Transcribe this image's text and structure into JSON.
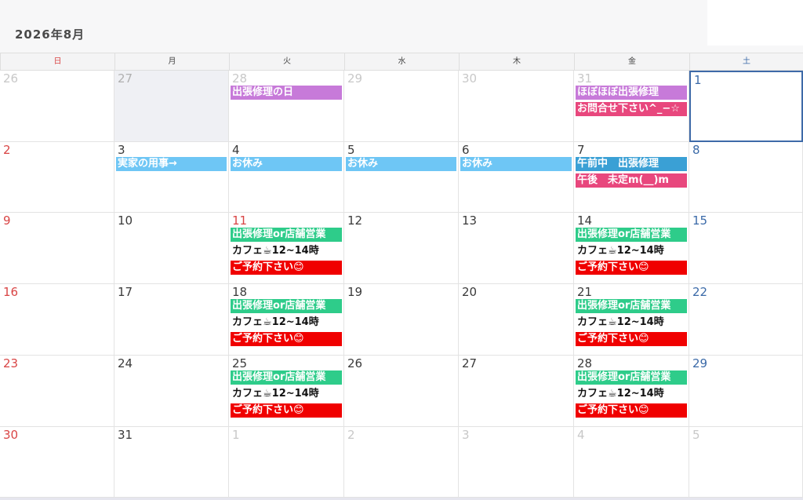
{
  "calendar": {
    "title": "2026年8月",
    "weekdays": [
      "日",
      "月",
      "火",
      "水",
      "木",
      "金",
      "土"
    ],
    "weekday_colors": [
      "#d94545",
      "#444444",
      "#444444",
      "#444444",
      "#444444",
      "#444444",
      "#3b6aa8"
    ],
    "weeks": [
      [
        {
          "day": "26",
          "kind": "other",
          "events": []
        },
        {
          "day": "27",
          "kind": "othergray",
          "gray": true,
          "events": []
        },
        {
          "day": "28",
          "kind": "other",
          "events": [
            {
              "text": "出張修理の日",
              "color": "#c77ad9"
            }
          ]
        },
        {
          "day": "29",
          "kind": "other",
          "events": []
        },
        {
          "day": "30",
          "kind": "other",
          "events": []
        },
        {
          "day": "31",
          "kind": "other",
          "events": [
            {
              "text": "ほぼほぼ出張修理",
              "color": "#c77ad9"
            },
            {
              "text": "お問合せ下さい^_−☆",
              "color": "#e8477d"
            }
          ]
        },
        {
          "day": "1",
          "kind": "sat",
          "selected": true,
          "events": []
        }
      ],
      [
        {
          "day": "2",
          "kind": "sun",
          "events": []
        },
        {
          "day": "3",
          "kind": "normal",
          "events": [
            {
              "text": "実家の用事→",
              "color": "#6ec6f5"
            }
          ]
        },
        {
          "day": "4",
          "kind": "normal",
          "events": [
            {
              "text": "お休み",
              "color": "#6ec6f5"
            }
          ]
        },
        {
          "day": "5",
          "kind": "normal",
          "events": [
            {
              "text": "お休み",
              "color": "#6ec6f5"
            }
          ]
        },
        {
          "day": "6",
          "kind": "normal",
          "events": [
            {
              "text": "お休み",
              "color": "#6ec6f5"
            }
          ]
        },
        {
          "day": "7",
          "kind": "normal",
          "events": [
            {
              "text": "午前中　出張修理",
              "color": "#3aa0d5"
            },
            {
              "text": "午後　未定m(__)m",
              "color": "#e8477d"
            }
          ]
        },
        {
          "day": "8",
          "kind": "sat",
          "events": []
        }
      ],
      [
        {
          "day": "9",
          "kind": "sun",
          "events": []
        },
        {
          "day": "10",
          "kind": "normal",
          "events": []
        },
        {
          "day": "11",
          "kind": "holiday",
          "events": [
            {
              "text": "出張修理or店舗営業",
              "color": "#2ecc8a"
            },
            {
              "text": "カフェ☕12~14時",
              "color": "plain"
            },
            {
              "text": "ご予約下さい😊",
              "color": "#f00000"
            }
          ]
        },
        {
          "day": "12",
          "kind": "normal",
          "events": []
        },
        {
          "day": "13",
          "kind": "normal",
          "events": []
        },
        {
          "day": "14",
          "kind": "normal",
          "events": [
            {
              "text": "出張修理or店舗営業",
              "color": "#2ecc8a"
            },
            {
              "text": "カフェ☕12~14時",
              "color": "plain"
            },
            {
              "text": "ご予約下さい😊",
              "color": "#f00000"
            }
          ]
        },
        {
          "day": "15",
          "kind": "sat",
          "events": []
        }
      ],
      [
        {
          "day": "16",
          "kind": "sun",
          "events": []
        },
        {
          "day": "17",
          "kind": "normal",
          "events": []
        },
        {
          "day": "18",
          "kind": "normal",
          "events": [
            {
              "text": "出張修理or店舗営業",
              "color": "#2ecc8a"
            },
            {
              "text": "カフェ☕12~14時",
              "color": "plain"
            },
            {
              "text": "ご予約下さい😊",
              "color": "#f00000"
            }
          ]
        },
        {
          "day": "19",
          "kind": "normal",
          "events": []
        },
        {
          "day": "20",
          "kind": "normal",
          "events": []
        },
        {
          "day": "21",
          "kind": "normal",
          "events": [
            {
              "text": "出張修理or店舗営業",
              "color": "#2ecc8a"
            },
            {
              "text": "カフェ☕12~14時",
              "color": "plain"
            },
            {
              "text": "ご予約下さい😊",
              "color": "#f00000"
            }
          ]
        },
        {
          "day": "22",
          "kind": "sat",
          "events": []
        }
      ],
      [
        {
          "day": "23",
          "kind": "sun",
          "events": []
        },
        {
          "day": "24",
          "kind": "normal",
          "events": []
        },
        {
          "day": "25",
          "kind": "normal",
          "events": [
            {
              "text": "出張修理or店舗営業",
              "color": "#2ecc8a"
            },
            {
              "text": "カフェ☕12~14時",
              "color": "plain"
            },
            {
              "text": "ご予約下さい😊",
              "color": "#f00000"
            }
          ]
        },
        {
          "day": "26",
          "kind": "normal",
          "events": []
        },
        {
          "day": "27",
          "kind": "normal",
          "events": []
        },
        {
          "day": "28",
          "kind": "normal",
          "events": [
            {
              "text": "出張修理or店舗営業",
              "color": "#2ecc8a"
            },
            {
              "text": "カフェ☕12~14時",
              "color": "plain"
            },
            {
              "text": "ご予約下さい😊",
              "color": "#f00000"
            }
          ]
        },
        {
          "day": "29",
          "kind": "sat",
          "events": []
        }
      ],
      [
        {
          "day": "30",
          "kind": "sun",
          "events": []
        },
        {
          "day": "31",
          "kind": "normal",
          "events": []
        },
        {
          "day": "1",
          "kind": "other",
          "events": []
        },
        {
          "day": "2",
          "kind": "other",
          "events": []
        },
        {
          "day": "3",
          "kind": "other",
          "events": []
        },
        {
          "day": "4",
          "kind": "other",
          "events": []
        },
        {
          "day": "5",
          "kind": "other",
          "events": []
        }
      ]
    ]
  }
}
